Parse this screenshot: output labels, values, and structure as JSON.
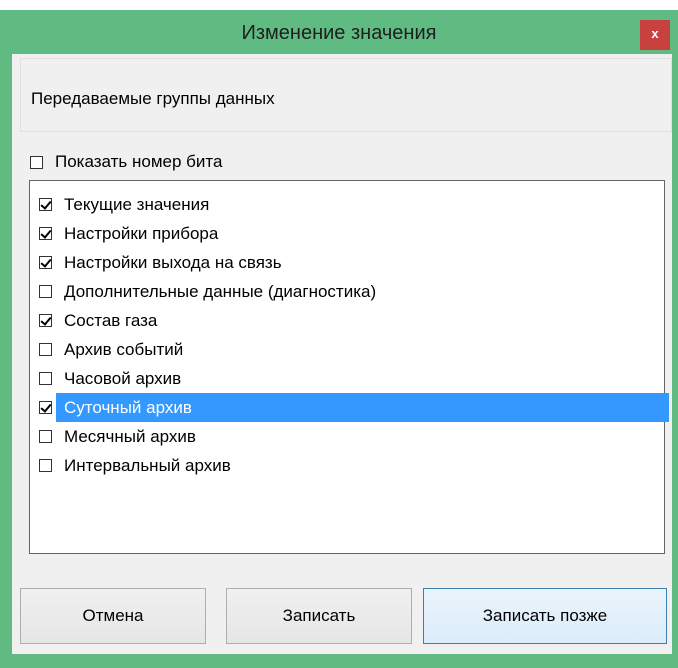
{
  "window": {
    "title": "Изменение значения",
    "close_label": "x"
  },
  "group_panel": {
    "label": "Передаваемые группы данных"
  },
  "show_bit": {
    "label": "Показать номер бита",
    "checked": false
  },
  "list": {
    "items": [
      {
        "label": "Текущие значения",
        "checked": true,
        "selected": false
      },
      {
        "label": "Настройки прибора",
        "checked": true,
        "selected": false
      },
      {
        "label": "Настройки выхода на связь",
        "checked": true,
        "selected": false
      },
      {
        "label": "Дополнительные данные (диагностика)",
        "checked": false,
        "selected": false
      },
      {
        "label": "Состав газа",
        "checked": true,
        "selected": false
      },
      {
        "label": "Архив событий",
        "checked": false,
        "selected": false
      },
      {
        "label": "Часовой архив",
        "checked": false,
        "selected": false
      },
      {
        "label": "Суточный архив",
        "checked": true,
        "selected": true
      },
      {
        "label": "Месячный архив",
        "checked": false,
        "selected": false
      },
      {
        "label": "Интервальный архив",
        "checked": false,
        "selected": false
      }
    ]
  },
  "buttons": {
    "cancel": "Отмена",
    "write": "Записать",
    "write_later": "Записать позже"
  },
  "colors": {
    "window_frame": "#5fbb82",
    "close_button": "#c7413f",
    "selection": "#3399ff"
  }
}
